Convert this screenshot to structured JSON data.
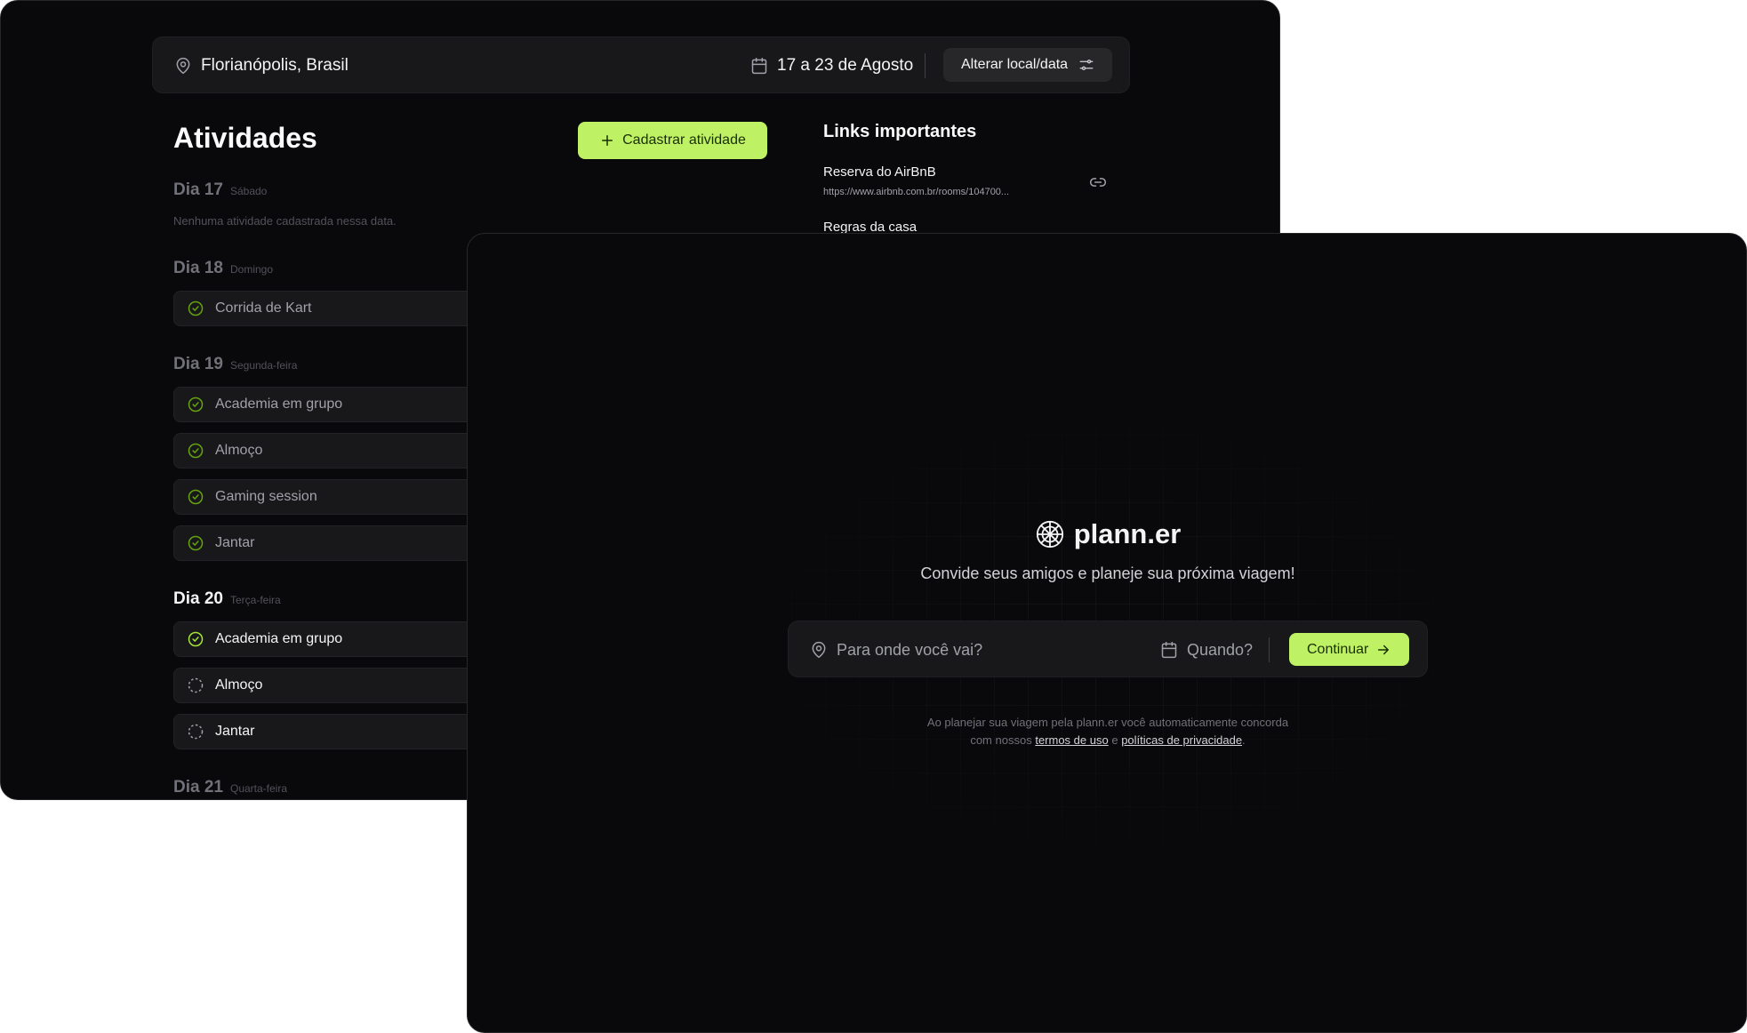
{
  "back": {
    "header": {
      "location": "Florianópolis, Brasil",
      "dates": "17 a 23 de Agosto",
      "change_button": "Alterar local/data"
    },
    "activities": {
      "title": "Atividades",
      "add_button": "Cadastrar atividade",
      "empty_text": "Nenhuma atividade cadastrada nessa data.",
      "days": [
        {
          "label": "Dia 17",
          "weekday": "Sábado"
        },
        {
          "label": "Dia 18",
          "weekday": "Domingo"
        },
        {
          "label": "Dia 19",
          "weekday": "Segunda-feira"
        },
        {
          "label": "Dia 20",
          "weekday": "Terça-feira"
        },
        {
          "label": "Dia 21",
          "weekday": "Quarta-feira"
        }
      ],
      "items": [
        {
          "day": "Dia 18",
          "name": "Corrida de Kart",
          "done": true
        },
        {
          "day": "Dia 19",
          "name": "Academia em grupo",
          "done": true
        },
        {
          "day": "Dia 19",
          "name": "Almoço",
          "done": true
        },
        {
          "day": "Dia 19",
          "name": "Gaming session",
          "done": true
        },
        {
          "day": "Dia 19",
          "name": "Jantar",
          "done": true
        },
        {
          "day": "Dia 20",
          "name": "Academia em grupo",
          "done": true
        },
        {
          "day": "Dia 20",
          "name": "Almoço",
          "done": false
        },
        {
          "day": "Dia 20",
          "name": "Jantar",
          "done": false
        }
      ]
    },
    "links": {
      "title": "Links importantes",
      "items": [
        {
          "name": "Reserva do AirBnB",
          "url": "https://www.airbnb.com.br/rooms/104700..."
        },
        {
          "name": "Regras da casa"
        }
      ]
    }
  },
  "front": {
    "logo": "plann.er",
    "tagline": "Convide seus amigos e planeje sua próxima viagem!",
    "destination_placeholder": "Para onde você vai?",
    "when_placeholder": "Quando?",
    "continue_button": "Continuar",
    "legal": {
      "line1": "Ao planejar sua viagem pela plann.er você automaticamente concorda",
      "prefix": "com nossos",
      "terms_link": "termos de uso",
      "conjunction": "e",
      "privacy_link": "políticas de privacidade",
      "suffix": "."
    }
  },
  "colors": {
    "background": "#09090b",
    "surface": "#18181b",
    "accent": "#bef264",
    "check_done": "#84cc16"
  },
  "icons": [
    "map-pin-icon",
    "calendar-icon",
    "settings-icon",
    "plus-icon",
    "circle-check-icon",
    "circle-dashed-icon",
    "link-icon",
    "globe-icon",
    "arrow-right-icon"
  ]
}
